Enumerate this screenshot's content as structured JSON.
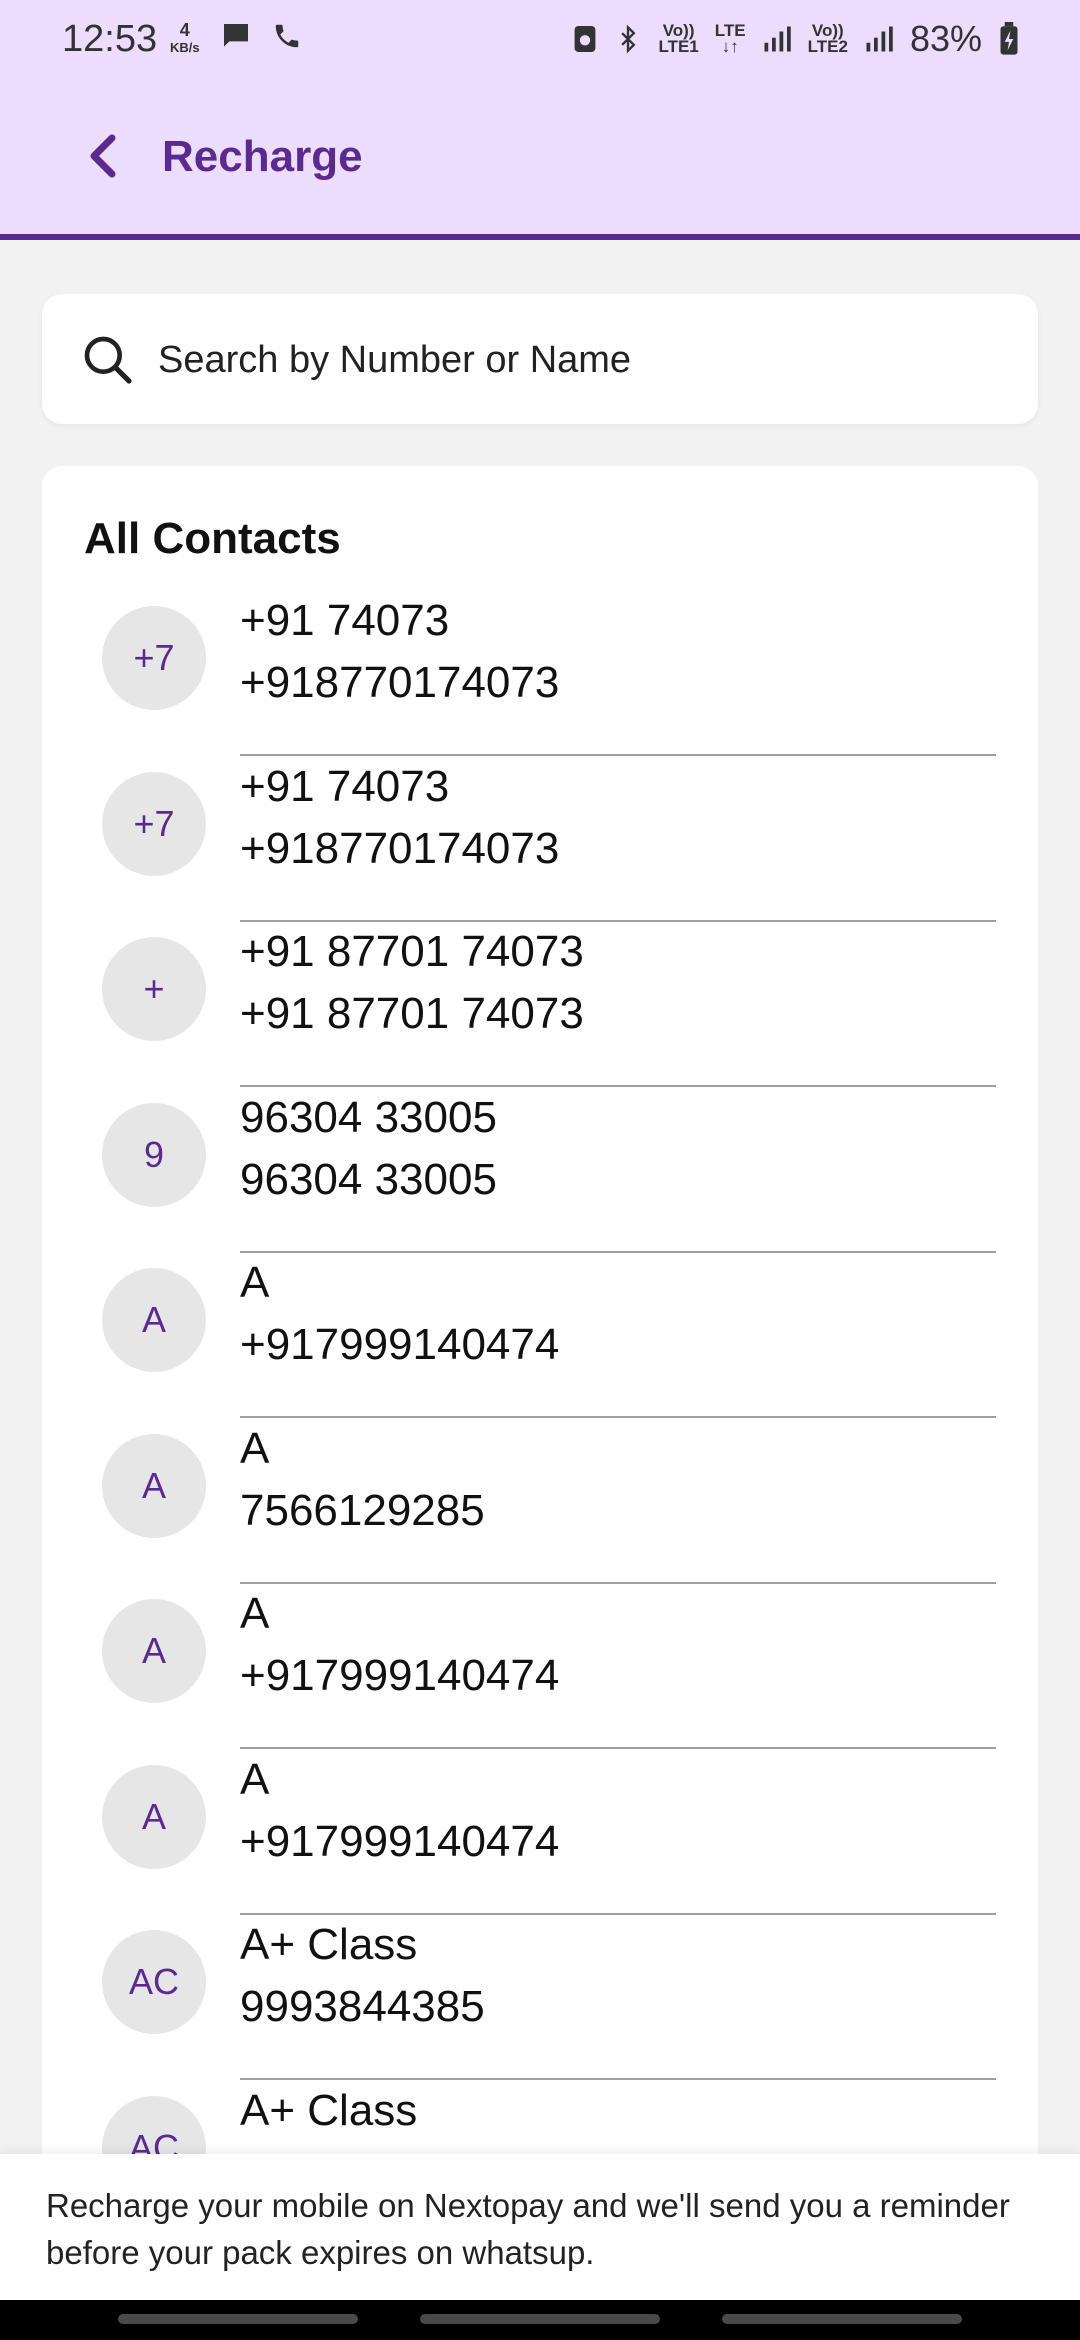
{
  "status_bar": {
    "time": "12:53",
    "network_speed_value": "4",
    "network_speed_unit": "KB/s",
    "sim1_label_top": "Vo))",
    "sim1_label_bottom": "LTE1",
    "lte_label_top": "LTE",
    "lte_label_bottom": "↓↑",
    "sim2_label_top": "Vo))",
    "sim2_label_bottom": "LTE2",
    "battery": "83%"
  },
  "header": {
    "title": "Recharge"
  },
  "search": {
    "placeholder": "Search by Number or Name"
  },
  "contacts": {
    "heading": "All Contacts",
    "items": [
      {
        "initials": "+7",
        "name": "+91 74073",
        "phone": "+918770174073"
      },
      {
        "initials": "+7",
        "name": "+91 74073",
        "phone": "+918770174073"
      },
      {
        "initials": "+",
        "name": "+91 87701 74073",
        "phone": "+91 87701 74073"
      },
      {
        "initials": "9",
        "name": "96304 33005",
        "phone": "96304 33005"
      },
      {
        "initials": "A",
        "name": "A",
        "phone": "+917999140474"
      },
      {
        "initials": "A",
        "name": "A",
        "phone": "7566129285"
      },
      {
        "initials": "A",
        "name": "A",
        "phone": "+917999140474"
      },
      {
        "initials": "A",
        "name": "A",
        "phone": "+917999140474"
      },
      {
        "initials": "AC",
        "name": "A+ Class",
        "phone": "9993844385"
      },
      {
        "initials": "AC",
        "name": "A+ Class",
        "phone": ""
      }
    ]
  },
  "banner": {
    "text": "Recharge your mobile on Nextopay and we'll send you a reminder before your pack expires on whatsup."
  },
  "colors": {
    "brand_purple": "#5b2a91",
    "header_background": "#ebddfb",
    "avatar_background": "#e6e6e6"
  }
}
